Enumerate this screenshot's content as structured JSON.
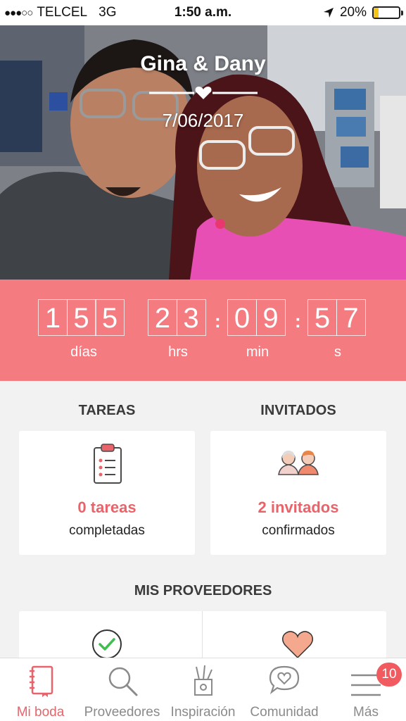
{
  "status_bar": {
    "carrier": "TELCEL",
    "network": "3G",
    "time": "1:50 a.m.",
    "battery": "20%",
    "battery_level": 0.2,
    "signal_icon": "signal-dots-icon",
    "location_icon": "location-arrow-icon"
  },
  "hero": {
    "names": "Gina & Dany",
    "date": "7/06/2017"
  },
  "countdown": {
    "days": "155",
    "hours": "23",
    "minutes": "09",
    "seconds": "57",
    "labels": {
      "days": "días",
      "hours": "hrs",
      "minutes": "min",
      "seconds": "s"
    }
  },
  "tasks": {
    "title": "TAREAS",
    "count": "0 tareas",
    "caption": "completadas",
    "icon": "clipboard-checklist-icon"
  },
  "guests": {
    "title": "INVITADOS",
    "count": "2 invitados",
    "caption": "confirmados",
    "icon": "guests-couple-icon"
  },
  "vendors": {
    "title": "MIS PROVEEDORES",
    "icons": [
      "check-circle-icon",
      "heart-icon"
    ]
  },
  "tabbar": {
    "items": [
      {
        "label": "Mi boda",
        "icon": "notebook-icon",
        "active": true
      },
      {
        "label": "Proveedores",
        "icon": "search-icon",
        "active": false
      },
      {
        "label": "Inspiración",
        "icon": "pencil-cup-icon",
        "active": false
      },
      {
        "label": "Comunidad",
        "icon": "chat-heart-icon",
        "active": false
      },
      {
        "label": "Más",
        "icon": "menu-icon",
        "active": false,
        "badge": "10"
      }
    ]
  },
  "colors": {
    "accent": "#f47c80",
    "accent_text": "#e8646a",
    "badge": "#f15a5e"
  }
}
